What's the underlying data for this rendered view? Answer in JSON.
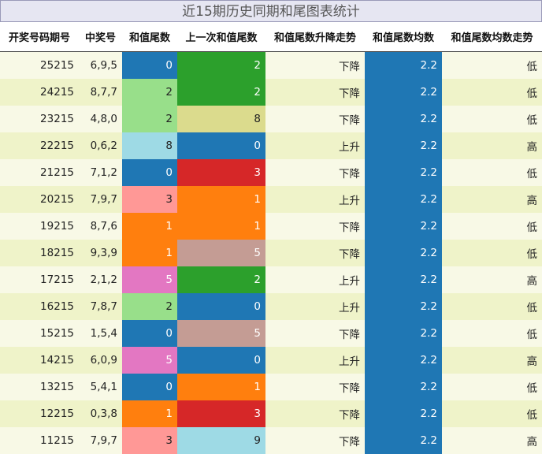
{
  "title": "近15期历史同期和尾图表统计",
  "columns": [
    "开奖号码期号",
    "中奖号",
    "和值尾数",
    "上一次和值尾数",
    "和值尾数升降走势",
    "和值尾数均数",
    "和值尾数均数走势"
  ],
  "rows": [
    {
      "period": "25215",
      "numbers": "6,9,5",
      "tail": "0",
      "prev_tail": "2",
      "trend": "下降",
      "avg": "2.2",
      "avg_trend": "低"
    },
    {
      "period": "24215",
      "numbers": "8,7,7",
      "tail": "2",
      "prev_tail": "2",
      "trend": "下降",
      "avg": "2.2",
      "avg_trend": "低"
    },
    {
      "period": "23215",
      "numbers": "4,8,0",
      "tail": "2",
      "prev_tail": "8",
      "trend": "下降",
      "avg": "2.2",
      "avg_trend": "低"
    },
    {
      "period": "22215",
      "numbers": "0,6,2",
      "tail": "8",
      "prev_tail": "0",
      "trend": "上升",
      "avg": "2.2",
      "avg_trend": "高"
    },
    {
      "period": "21215",
      "numbers": "7,1,2",
      "tail": "0",
      "prev_tail": "3",
      "trend": "下降",
      "avg": "2.2",
      "avg_trend": "低"
    },
    {
      "period": "20215",
      "numbers": "7,9,7",
      "tail": "3",
      "prev_tail": "1",
      "trend": "上升",
      "avg": "2.2",
      "avg_trend": "高"
    },
    {
      "period": "19215",
      "numbers": "8,7,6",
      "tail": "1",
      "prev_tail": "1",
      "trend": "下降",
      "avg": "2.2",
      "avg_trend": "低"
    },
    {
      "period": "18215",
      "numbers": "9,3,9",
      "tail": "1",
      "prev_tail": "5",
      "trend": "下降",
      "avg": "2.2",
      "avg_trend": "低"
    },
    {
      "period": "17215",
      "numbers": "2,1,2",
      "tail": "5",
      "prev_tail": "2",
      "trend": "上升",
      "avg": "2.2",
      "avg_trend": "高"
    },
    {
      "period": "16215",
      "numbers": "7,8,7",
      "tail": "2",
      "prev_tail": "0",
      "trend": "上升",
      "avg": "2.2",
      "avg_trend": "低"
    },
    {
      "period": "15215",
      "numbers": "1,5,4",
      "tail": "0",
      "prev_tail": "5",
      "trend": "下降",
      "avg": "2.2",
      "avg_trend": "低"
    },
    {
      "period": "14215",
      "numbers": "6,0,9",
      "tail": "5",
      "prev_tail": "0",
      "trend": "上升",
      "avg": "2.2",
      "avg_trend": "高"
    },
    {
      "period": "13215",
      "numbers": "5,4,1",
      "tail": "0",
      "prev_tail": "1",
      "trend": "下降",
      "avg": "2.2",
      "avg_trend": "低"
    },
    {
      "period": "12215",
      "numbers": "0,3,8",
      "tail": "1",
      "prev_tail": "3",
      "trend": "下降",
      "avg": "2.2",
      "avg_trend": "低"
    },
    {
      "period": "11215",
      "numbers": "7,9,7",
      "tail": "3",
      "prev_tail": "9",
      "trend": "下降",
      "avg": "2.2",
      "avg_trend": "高"
    }
  ],
  "digit_colors": {
    "0": "#1f77b4",
    "1": "#ff7f0e",
    "2": "#2ca02c",
    "3": "#d62728",
    "5": "#c49c94",
    "8": "#dbdb8d",
    "9": "#9edae5"
  },
  "tail_colors": {
    "0": "#1f77b4",
    "1": "#ff7f0e",
    "2": "#98df8a",
    "3": "#ff9896",
    "5": "#e377c2",
    "8": "#9edae5"
  },
  "avg_color": "#1f77b4"
}
